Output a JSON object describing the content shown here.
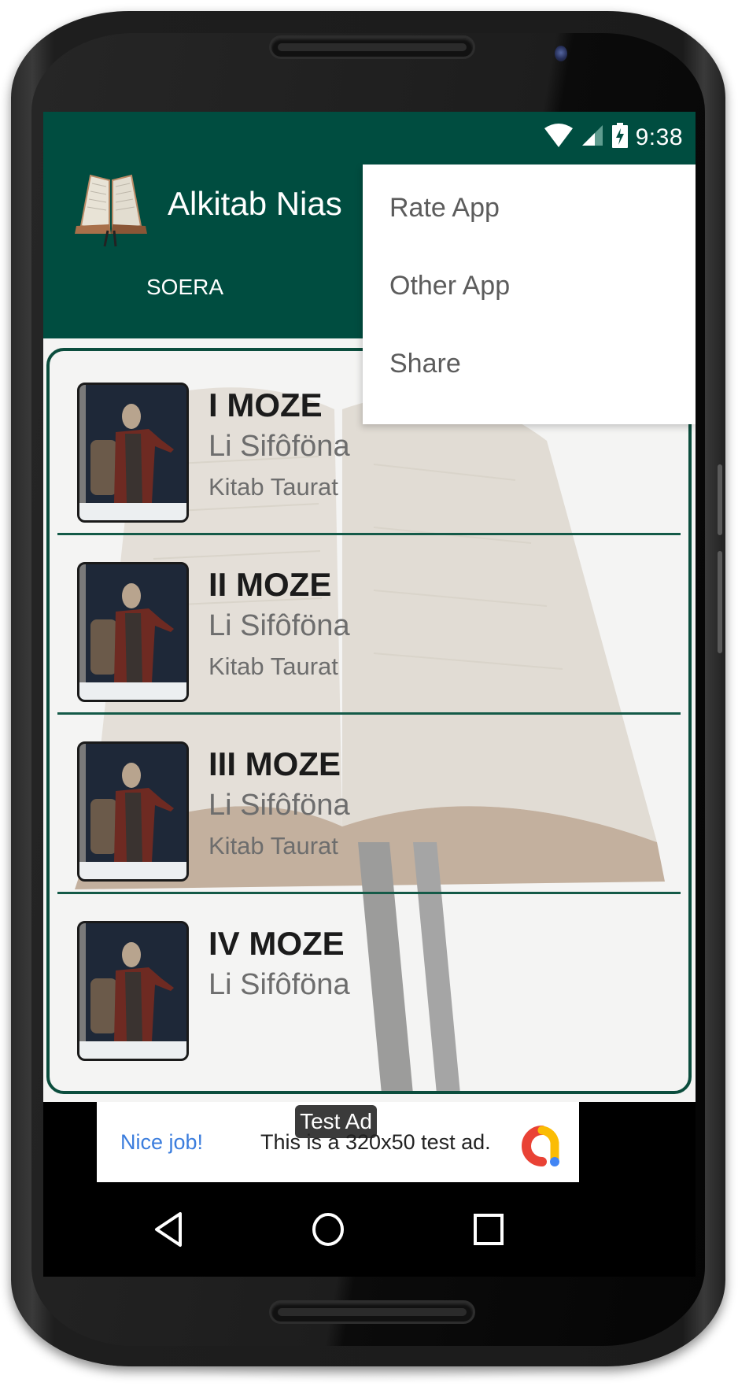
{
  "status_bar": {
    "time": "9:38",
    "icons": [
      "wifi-icon",
      "cell-signal-icon",
      "battery-charging-icon"
    ]
  },
  "app_bar": {
    "logo_icon": "open-bible-icon",
    "title": "Alkitab Nias",
    "tabs": [
      {
        "label": "SOERA",
        "active": true
      }
    ]
  },
  "overflow_menu": {
    "items": [
      {
        "label": "Rate App"
      },
      {
        "label": "Other App"
      },
      {
        "label": "Share"
      }
    ]
  },
  "books": [
    {
      "title": "I MOZE",
      "subtitle": "Li Sifôföna",
      "category": "Kitab Taurat",
      "cover_icon": "moses-cover-image"
    },
    {
      "title": "II MOZE",
      "subtitle": "Li Sifôföna",
      "category": "Kitab Taurat",
      "cover_icon": "moses-cover-image"
    },
    {
      "title": "III MOZE",
      "subtitle": "Li Sifôföna",
      "category": "Kitab Taurat",
      "cover_icon": "moses-cover-image"
    },
    {
      "title": "IV MOZE",
      "subtitle": "Li Sifôföna",
      "category": "",
      "cover_icon": "moses-cover-image"
    }
  ],
  "ad": {
    "badge": "Test Ad",
    "cta": "Nice job!",
    "text": "This is a 320x50 test ad.",
    "logo_icon": "admob-logo-icon",
    "colors": {
      "red": "#e94235",
      "yellow": "#fbbc04",
      "blue": "#4285f4"
    }
  },
  "nav_bar": {
    "buttons": [
      "back-icon",
      "home-icon",
      "recents-icon"
    ]
  },
  "theme": {
    "primary": "#004d40",
    "divider": "#145a48",
    "menu_text": "#5c5c5c",
    "cta_blue": "#3b7ddd"
  }
}
